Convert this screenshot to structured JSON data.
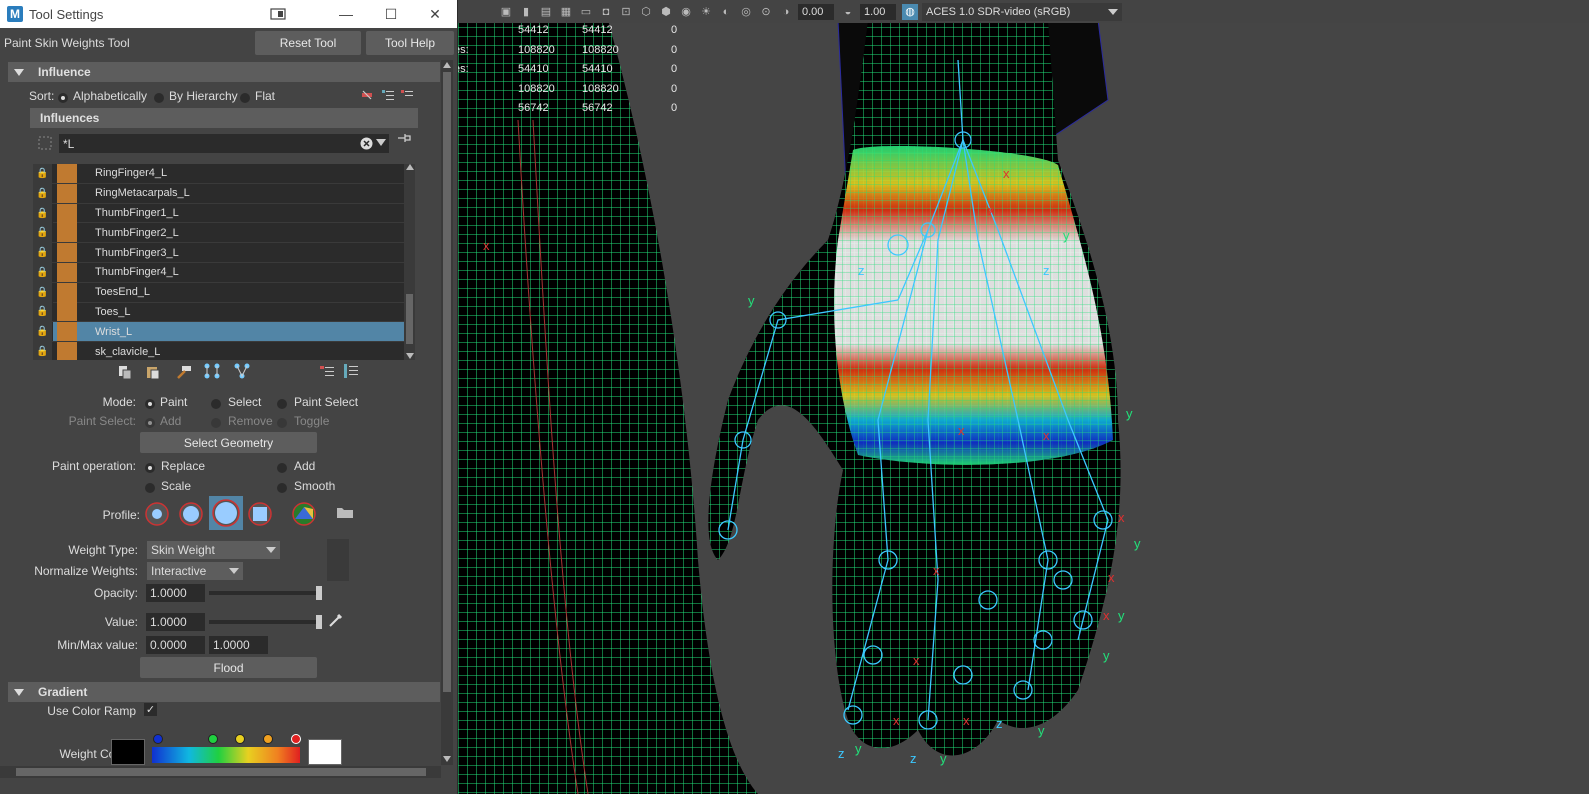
{
  "window": {
    "title": "Tool Settings",
    "minimize_glyph": "—",
    "maximize_glyph": "☐",
    "close_glyph": "✕"
  },
  "tool": {
    "name": "Paint Skin Weights Tool",
    "reset_label": "Reset Tool",
    "help_label": "Tool Help"
  },
  "influence": {
    "header": "Influence",
    "sort_label": "Sort:",
    "sort_options": [
      "Alphabetically",
      "By Hierarchy",
      "Flat"
    ],
    "sort_selected": "Alphabetically",
    "influences_header": "Influences",
    "filter_value": "*L",
    "items": [
      {
        "label": "RingFinger4_L",
        "selected": false
      },
      {
        "label": "RingMetacarpals_L",
        "selected": false
      },
      {
        "label": "ThumbFinger1_L",
        "selected": false
      },
      {
        "label": "ThumbFinger2_L",
        "selected": false
      },
      {
        "label": "ThumbFinger3_L",
        "selected": false
      },
      {
        "label": "ThumbFinger4_L",
        "selected": false
      },
      {
        "label": "ToesEnd_L",
        "selected": false
      },
      {
        "label": "Toes_L",
        "selected": false
      },
      {
        "label": "Wrist_L",
        "selected": true
      },
      {
        "label": "sk_clavicle_L",
        "selected": false
      }
    ]
  },
  "mode": {
    "label": "Mode:",
    "options": [
      "Paint",
      "Select",
      "Paint Select"
    ],
    "selected": "Paint"
  },
  "paint_select": {
    "label": "Paint Select:",
    "options": [
      "Add",
      "Remove",
      "Toggle"
    ]
  },
  "select_geometry_label": "Select Geometry",
  "paint_operation": {
    "label": "Paint operation:",
    "options": [
      "Replace",
      "Add",
      "Scale",
      "Smooth"
    ],
    "selected": "Replace"
  },
  "profile_label": "Profile:",
  "weight_type": {
    "label": "Weight Type:",
    "value": "Skin Weight"
  },
  "normalize_weights": {
    "label": "Normalize Weights:",
    "value": "Interactive"
  },
  "opacity": {
    "label": "Opacity:",
    "value": "1.0000",
    "level": 1.0
  },
  "value": {
    "label": "Value:",
    "value": "1.0000",
    "level": 1.0
  },
  "minmax": {
    "label": "Min/Max value:",
    "min": "0.0000",
    "max": "1.0000"
  },
  "flood_label": "Flood",
  "gradient": {
    "header": "Gradient",
    "use_color_ramp_label": "Use Color Ramp",
    "use_color_ramp_checked": true,
    "weight_color_label": "Weight Color:"
  },
  "viewport": {
    "exposure": "0.00",
    "gamma": "1.00",
    "color_space": "ACES 1.0 SDR-video (sRGB)",
    "hud_rows": [
      {
        "prefix": "",
        "a": "54412",
        "b": "54412",
        "c": "0"
      },
      {
        "prefix": "es:",
        "a": "108820",
        "b": "108820",
        "c": "0"
      },
      {
        "prefix": "es:",
        "a": "54410",
        "b": "54410",
        "c": "0"
      },
      {
        "prefix": "",
        "a": "108820",
        "b": "108820",
        "c": "0"
      },
      {
        "prefix": "",
        "a": "56742",
        "b": "56742",
        "c": "0"
      }
    ]
  },
  "colors": {
    "panel_bg": "#444444",
    "section_bg": "#5d5d5d",
    "field_bg": "#2b2b2b",
    "selection": "#5285a6",
    "influence_swatch": "#c07a30",
    "wireframe": "#22e07a",
    "joint": "#3cc8ff"
  }
}
